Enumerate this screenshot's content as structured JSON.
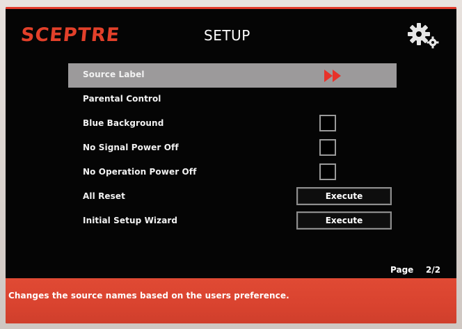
{
  "brand": {
    "name": "SCEPTRE",
    "color": "#e2402a"
  },
  "header": {
    "title": "SETUP",
    "settings_icon": "gear-icon"
  },
  "menu": {
    "items": [
      {
        "label": "Source Label",
        "control": "arrow",
        "icon": "double-chevron-right-icon",
        "highlighted": true
      },
      {
        "label": "Parental Control",
        "control": "none"
      },
      {
        "label": "Blue Background",
        "control": "checkbox",
        "checked": false
      },
      {
        "label": "No Signal Power Off",
        "control": "checkbox",
        "checked": false
      },
      {
        "label": "No Operation Power Off",
        "control": "checkbox",
        "checked": false
      },
      {
        "label": "All Reset",
        "control": "button",
        "button_label": "Execute"
      },
      {
        "label": "Initial Setup Wizard",
        "control": "button",
        "button_label": "Execute"
      }
    ]
  },
  "pagination": {
    "label": "Page",
    "value": "2/2"
  },
  "footer": {
    "help_text": "Changes the source names based on the users preference."
  },
  "colors": {
    "accent_red": "#e2402a",
    "highlight_gray": "#9c9a9b",
    "screen_black": "#050505"
  }
}
